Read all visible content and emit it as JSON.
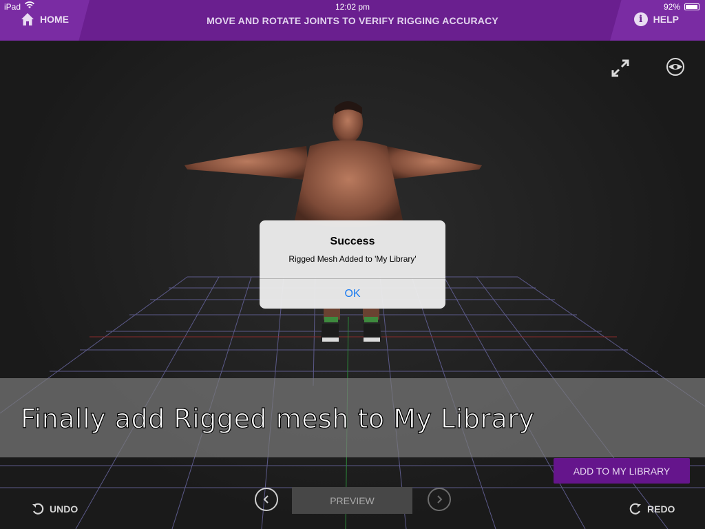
{
  "status_bar": {
    "device": "iPad",
    "time": "12:02 pm",
    "battery": "92%"
  },
  "header": {
    "home_label": "HOME",
    "title": "MOVE AND ROTATE JOINTS TO VERIFY RIGGING ACCURACY",
    "help_label": "HELP",
    "help_icon_glyph": "i",
    "color": "#6a1f8f"
  },
  "viewport": {
    "icons": [
      "expand-icon",
      "eye-icon"
    ]
  },
  "caption": {
    "text": "Finally add Rigged mesh to My Library"
  },
  "dialog": {
    "title": "Success",
    "message": "Rigged Mesh Added to 'My Library'",
    "ok_label": "OK",
    "ok_color": "#1a7bf0"
  },
  "controls": {
    "add_to_library_label": "ADD TO MY LIBRARY",
    "undo_label": "UNDO",
    "redo_label": "REDO",
    "preview_label": "PREVIEW",
    "accent": "#65158c"
  }
}
